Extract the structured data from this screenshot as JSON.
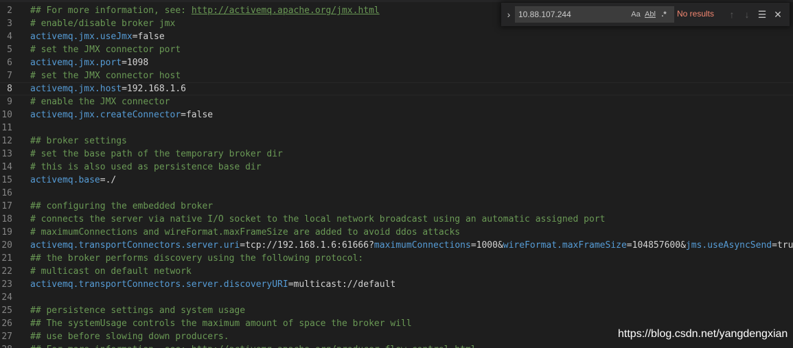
{
  "find_widget": {
    "query": "10.88.107.244",
    "status": "No results",
    "options": {
      "match_case": "Aa",
      "whole_word": "Abl",
      "regex": ".*"
    },
    "icons": {
      "toggle_replace": "chevron-right-icon",
      "previous": "arrow-up-icon",
      "next": "arrow-down-icon",
      "find_in_selection": "list-lines-icon",
      "close": "close-icon"
    }
  },
  "editor": {
    "active_line": 8,
    "lines": [
      {
        "number": "2",
        "segments": [
          {
            "t": "## For more information, see: ",
            "cls": "c"
          },
          {
            "t": "http://activemq.apache.org/jmx.html",
            "cls": "lnk"
          }
        ]
      },
      {
        "number": "3",
        "segments": [
          {
            "t": "# enable/disable broker jmx",
            "cls": "c"
          }
        ]
      },
      {
        "number": "4",
        "segments": [
          {
            "t": "activemq.jmx.useJmx",
            "cls": "k"
          },
          {
            "t": "=false",
            "cls": "v"
          }
        ]
      },
      {
        "number": "5",
        "segments": [
          {
            "t": "# set the JMX connector port",
            "cls": "c"
          }
        ]
      },
      {
        "number": "6",
        "segments": [
          {
            "t": "activemq.jmx.port",
            "cls": "k"
          },
          {
            "t": "=1098",
            "cls": "v"
          }
        ]
      },
      {
        "number": "7",
        "segments": [
          {
            "t": "# set the JMX connector host",
            "cls": "c"
          }
        ]
      },
      {
        "number": "8",
        "segments": [
          {
            "t": "activemq.jmx.host",
            "cls": "k"
          },
          {
            "t": "=192.168.1.6",
            "cls": "v"
          }
        ]
      },
      {
        "number": "9",
        "segments": [
          {
            "t": "# enable the JMX connector",
            "cls": "c"
          }
        ]
      },
      {
        "number": "10",
        "segments": [
          {
            "t": "activemq.jmx.createConnector",
            "cls": "k"
          },
          {
            "t": "=false",
            "cls": "v"
          }
        ]
      },
      {
        "number": "11",
        "segments": []
      },
      {
        "number": "12",
        "segments": [
          {
            "t": "## broker settings",
            "cls": "c"
          }
        ]
      },
      {
        "number": "13",
        "segments": [
          {
            "t": "# set the base path of the temporary broker dir",
            "cls": "c"
          }
        ]
      },
      {
        "number": "14",
        "segments": [
          {
            "t": "# this is also used as persistence base dir",
            "cls": "c"
          }
        ]
      },
      {
        "number": "15",
        "segments": [
          {
            "t": "activemq.base",
            "cls": "k"
          },
          {
            "t": "=./",
            "cls": "v"
          }
        ]
      },
      {
        "number": "16",
        "segments": []
      },
      {
        "number": "17",
        "segments": [
          {
            "t": "## configuring the embedded broker",
            "cls": "c"
          }
        ]
      },
      {
        "number": "18",
        "segments": [
          {
            "t": "# connects the server via native I/O socket to the local network broadcast using an automatic assigned port",
            "cls": "c"
          }
        ]
      },
      {
        "number": "19",
        "segments": [
          {
            "t": "# maximumConnections and wireFormat.maxFrameSize are added to avoid ddos attacks",
            "cls": "c"
          }
        ]
      },
      {
        "number": "20",
        "segments": [
          {
            "t": "activemq.transportConnectors.server.uri",
            "cls": "k"
          },
          {
            "t": "=tcp://192.168.1.6:61666?",
            "cls": "v"
          },
          {
            "t": "maximumConnections",
            "cls": "k"
          },
          {
            "t": "=1000&",
            "cls": "v"
          },
          {
            "t": "wireFormat.maxFrameSize",
            "cls": "k"
          },
          {
            "t": "=104857600&",
            "cls": "v"
          },
          {
            "t": "jms.useAsyncSend",
            "cls": "k"
          },
          {
            "t": "=true&t",
            "cls": "v"
          }
        ]
      },
      {
        "number": "21",
        "segments": [
          {
            "t": "## the broker performs discovery using the following protocol:",
            "cls": "c"
          }
        ]
      },
      {
        "number": "22",
        "segments": [
          {
            "t": "# multicast on default network",
            "cls": "c"
          }
        ]
      },
      {
        "number": "23",
        "segments": [
          {
            "t": "activemq.transportConnectors.server.discoveryURI",
            "cls": "k"
          },
          {
            "t": "=multicast://default",
            "cls": "v"
          }
        ]
      },
      {
        "number": "24",
        "segments": []
      },
      {
        "number": "25",
        "segments": [
          {
            "t": "## persistence settings and system usage",
            "cls": "c"
          }
        ]
      },
      {
        "number": "26",
        "segments": [
          {
            "t": "## The systemUsage controls the maximum amount of space the broker will",
            "cls": "c"
          }
        ]
      },
      {
        "number": "27",
        "segments": [
          {
            "t": "## use before slowing down producers.",
            "cls": "c"
          }
        ]
      },
      {
        "number": "28",
        "segments": [
          {
            "t": "## For more information, see: http://activemq.apache.org/producer-flow-control.html",
            "cls": "c"
          }
        ]
      }
    ]
  },
  "watermark": "https://blog.csdn.net/yangdengxian"
}
